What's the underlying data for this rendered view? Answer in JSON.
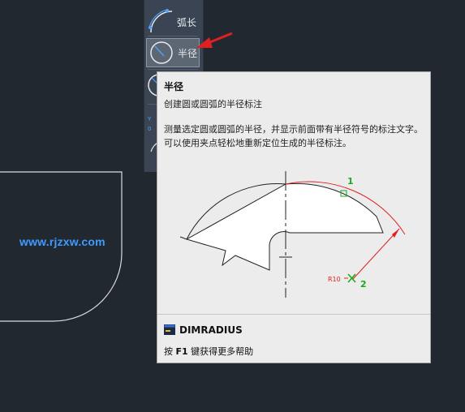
{
  "dropdown": {
    "items": [
      {
        "label": "弧长",
        "icon": "arc-length-icon"
      },
      {
        "label": "半径",
        "icon": "radius-dim-icon"
      }
    ]
  },
  "watermark": "www.rjzxw.com",
  "tooltip": {
    "title": "半径",
    "subtitle": "创建圆或圆弧的半径标注",
    "description": "测量选定圆或圆弧的半径，并显示前面带有半径符号的标注文字。可以使用夹点轻松地重新定位生成的半径标注。",
    "illustration": {
      "point1": "1",
      "point2": "2",
      "dim_text": "R10"
    },
    "command": "DIMRADIUS",
    "help_prefix": "按 ",
    "help_key": "F1",
    "help_suffix": " 键获得更多帮助"
  },
  "colors": {
    "background": "#212830",
    "panel": "#3b4452",
    "tooltip_bg": "#ececec",
    "accent_red": "#e02020",
    "green": "#1aaa1a",
    "watermark_blue": "#3f9bff"
  }
}
